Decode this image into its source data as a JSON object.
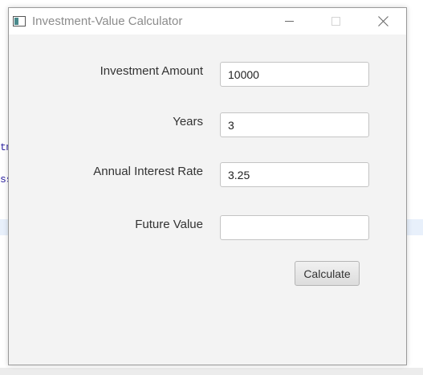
{
  "background": {
    "code_fragments": [
      "tm",
      "ss"
    ]
  },
  "window": {
    "title": "Investment-Value Calculator",
    "icons": {
      "app": "app-window-icon",
      "minimize": "minimize-icon",
      "maximize": "maximize-icon",
      "close": "close-icon"
    }
  },
  "form": {
    "investment_amount": {
      "label": "Investment Amount",
      "value": "10000"
    },
    "years": {
      "label": "Years",
      "value": "3"
    },
    "annual_interest_rate": {
      "label": "Annual Interest Rate",
      "value": "3.25"
    },
    "future_value": {
      "label": "Future Value",
      "value": ""
    },
    "calculate_label": "Calculate"
  }
}
